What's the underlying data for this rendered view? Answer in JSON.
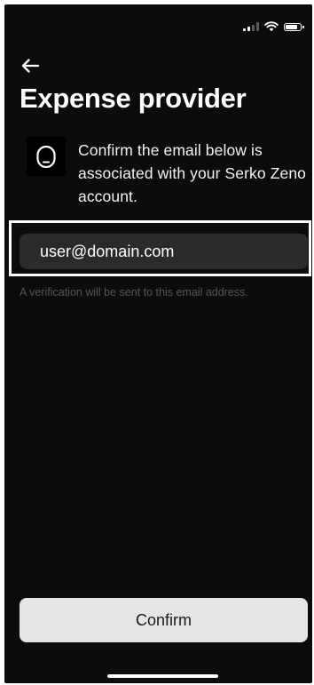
{
  "status_bar": {
    "signal_icon": "cellular-signal-icon",
    "wifi_icon": "wifi-icon",
    "battery_icon": "battery-icon"
  },
  "header": {
    "back_icon": "arrow-left-icon",
    "title": "Expense provider"
  },
  "provider": {
    "logo_icon": "serko-zeno-logo-icon",
    "message": "Confirm the email below is associated with your Serko Zeno account."
  },
  "email": {
    "value": "user@domain.com",
    "helper": "A verification will be sent to this email address."
  },
  "actions": {
    "confirm_label": "Confirm"
  },
  "colors": {
    "background": "#0c0c0c",
    "field_background": "#2b2b2b",
    "button_background": "#e5e5e5",
    "helper_text": "#555555"
  }
}
